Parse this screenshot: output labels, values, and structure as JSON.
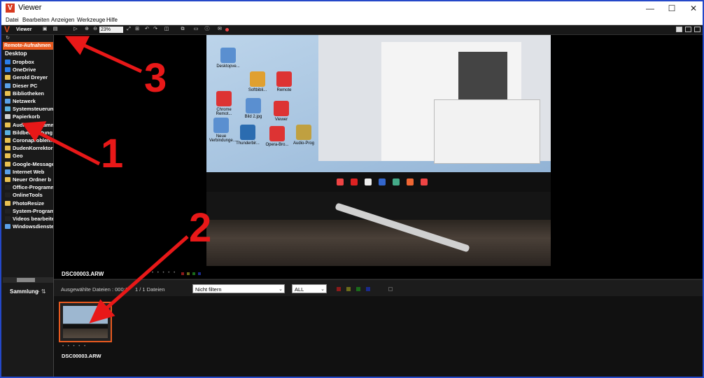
{
  "window": {
    "title": "Viewer",
    "app_icon": "V",
    "minimize": "—",
    "maximize": "☐",
    "close": "✕"
  },
  "menu": [
    "Datei",
    "Bearbeiten",
    "Anzeigen",
    "Werkzeuge",
    "Hilfe"
  ],
  "toolbar": {
    "logo": "V",
    "mode_label": "Viewer",
    "zoom_value": "23%"
  },
  "sidebar": {
    "remote": "Remote-Aufnahmen",
    "desktop": "Desktop",
    "items": [
      {
        "label": "Dropbox",
        "color": "#2b7de9"
      },
      {
        "label": "OneDrive",
        "color": "#2b7de9"
      },
      {
        "label": "Gerold Dreyer",
        "color": "#e8c050"
      },
      {
        "label": "Dieser PC",
        "color": "#5aa0e8"
      },
      {
        "label": "Bibliotheken",
        "color": "#e8c050"
      },
      {
        "label": "Netzwerk",
        "color": "#5aa0e8"
      },
      {
        "label": "Systemsteuerung",
        "color": "#5ab0e0"
      },
      {
        "label": "Papierkorb",
        "color": "#cfcfcf"
      },
      {
        "label": "Audio-Programme",
        "color": "#e8c050"
      },
      {
        "label": "Bildbearbeitung",
        "color": "#5ab0e0"
      },
      {
        "label": "Coronaprobleme",
        "color": "#e8c050"
      },
      {
        "label": "DudenKorrektor",
        "color": "#e8c050"
      },
      {
        "label": "Geo",
        "color": "#e8c050"
      },
      {
        "label": "Google-Messages",
        "color": "#e8c050"
      },
      {
        "label": "Internet Web",
        "color": "#5aa0e8"
      },
      {
        "label": "Neuer Ordner b",
        "color": "#e8c050"
      },
      {
        "label": "Office-Programme",
        "color": "#222"
      },
      {
        "label": "OnlineTools",
        "color": "#222"
      },
      {
        "label": "PhotoResize",
        "color": "#e8c050"
      },
      {
        "label": "System-Programme",
        "color": "#222"
      },
      {
        "label": "Videos bearbeiten",
        "color": "#222"
      },
      {
        "label": "Windowsdienste",
        "color": "#5aa0e8"
      }
    ],
    "collection": "Sammlung",
    "collection_icons": "+  ⇅"
  },
  "viewer": {
    "filename": "DSC00003.ARW",
    "rating_dots": "• • • • •",
    "color_labels": [
      "#8b1a1a",
      "#6b6b1a",
      "#1a6b1a",
      "#1a2a8b"
    ],
    "photo_desktop_icons": [
      {
        "label": "Desktopve..."
      },
      {
        "label": "Softbibli..."
      },
      {
        "label": "Remote"
      },
      {
        "label": "Chrome Remot..."
      },
      {
        "label": "Bild 2.jpg"
      },
      {
        "label": "Viewer"
      },
      {
        "label": "Neue Verbindunge..."
      },
      {
        "label": "Thunderbir..."
      },
      {
        "label": "Opera-Bro..."
      },
      {
        "label": "Audio-Prog"
      }
    ]
  },
  "filter_bar": {
    "selected": "Ausgewählte Dateien : 000:1",
    "count": "1 / 1 Dateien",
    "filter_value": "Nicht filtern",
    "all_value": "ALL",
    "swatches": [
      "#8b1a1a",
      "#6b6b1a",
      "#1a6b1a",
      "#1a2a8b"
    ]
  },
  "thumbnail": {
    "filename": "DSC00003.ARW",
    "rating_dots": "• • • • •"
  },
  "annotations": [
    "1",
    "2",
    "3"
  ]
}
